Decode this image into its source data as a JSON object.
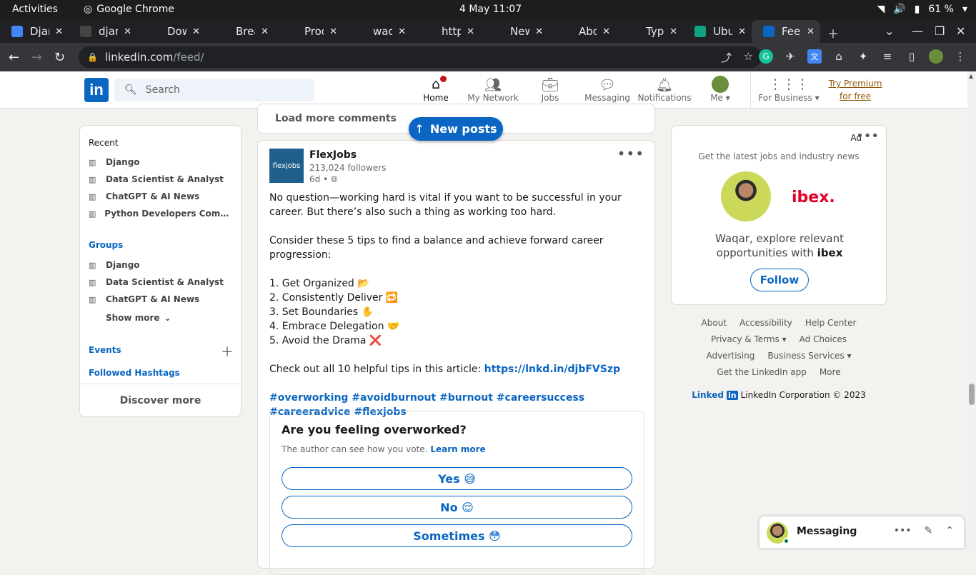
{
  "system": {
    "activities": "Activities",
    "app": "Google Chrome",
    "clock": "4 May  11:07",
    "battery": "61 %"
  },
  "tabs": [
    {
      "title": "Django",
      "color": "#4285f4"
    },
    {
      "title": "django",
      "color": "#444"
    },
    {
      "title": "Downloads",
      "color": "#202124"
    },
    {
      "title": "Break",
      "color": "#202124"
    },
    {
      "title": "Prod",
      "color": "#202124"
    },
    {
      "title": "waqar",
      "color": "#202124"
    },
    {
      "title": "https",
      "color": "#202124"
    },
    {
      "title": "New",
      "color": "#202124"
    },
    {
      "title": "About",
      "color": "#202124"
    },
    {
      "title": "Type",
      "color": "#202124"
    },
    {
      "title": "Ubuntu",
      "color": "#10a37f"
    },
    {
      "title": "Feed",
      "color": "#0a66c2"
    }
  ],
  "url": {
    "domain": "linkedin.com",
    "path": "/feed/"
  },
  "nav": {
    "logo": "in",
    "search_placeholder": "Search",
    "items": [
      {
        "label": "Home",
        "icon": "home-icon"
      },
      {
        "label": "My Network",
        "icon": "network-icon"
      },
      {
        "label": "Jobs",
        "icon": "briefcase-icon"
      },
      {
        "label": "Messaging",
        "icon": "chat-icon"
      },
      {
        "label": "Notifications",
        "icon": "bell-icon"
      },
      {
        "label": "Me",
        "icon": "avatar"
      },
      {
        "label": "For Business",
        "icon": "grid-icon"
      }
    ],
    "premium": "Try Premium for free"
  },
  "left": {
    "recent_title": "Recent",
    "recent": [
      "Django",
      "Data Scientist & Analyst",
      "ChatGPT & AI News",
      "Python Developers Community"
    ],
    "groups_title": "Groups",
    "groups": [
      "Django",
      "Data Scientist & Analyst",
      "ChatGPT & AI News"
    ],
    "show_more": "Show more",
    "events": "Events",
    "hashtags": "Followed Hashtags",
    "discover": "Discover more"
  },
  "feed": {
    "load_more": "Load more comments",
    "new_posts": "New posts",
    "post": {
      "author": "FlexJobs",
      "avatar_text": "flexjobs",
      "followers": "213,024 followers",
      "time": "6d •",
      "p1": "No question—working hard is vital if you want to be successful in your career. But there’s also such a thing as working too hard.",
      "p2": "Consider these 5 tips to find a balance and achieve forward career progression:",
      "tips": [
        "1. Get Organized 📂",
        "2. Consistently Deliver 🔁",
        "3. Set Boundaries ✋",
        "4. Embrace Delegation 🤝",
        "5. Avoid the Drama ❌"
      ],
      "p3": "Check out all 10 helpful tips in this article: ",
      "link": "https://lnkd.in/djbFVSzp",
      "hashtags": "#overworking #avoidburnout #burnout #careersuccess #careeradvice #flexjobs"
    },
    "poll": {
      "question": "Are you feeling overworked?",
      "sub": "The author can see how you vote.",
      "learn": "Learn more",
      "options": [
        "Yes 😅",
        "No 😌",
        "Sometimes 😳"
      ]
    }
  },
  "ad": {
    "label": "Ad",
    "headline": "Get the latest jobs and industry news",
    "brand": "ibex.",
    "message_pre": "Waqar, explore relevant opportunities with ",
    "message_brand": "ibex",
    "follow": "Follow"
  },
  "footer": {
    "row1": [
      "About",
      "Accessibility",
      "Help Center"
    ],
    "row2": [
      "Privacy & Terms",
      "Ad Choices"
    ],
    "row3": [
      "Advertising",
      "Business Services"
    ],
    "row4": [
      "Get the LinkedIn app",
      "More"
    ],
    "brand_text": "Linked",
    "brand_in": "in",
    "copyright": "LinkedIn Corporation © 2023"
  },
  "messaging": {
    "label": "Messaging"
  }
}
